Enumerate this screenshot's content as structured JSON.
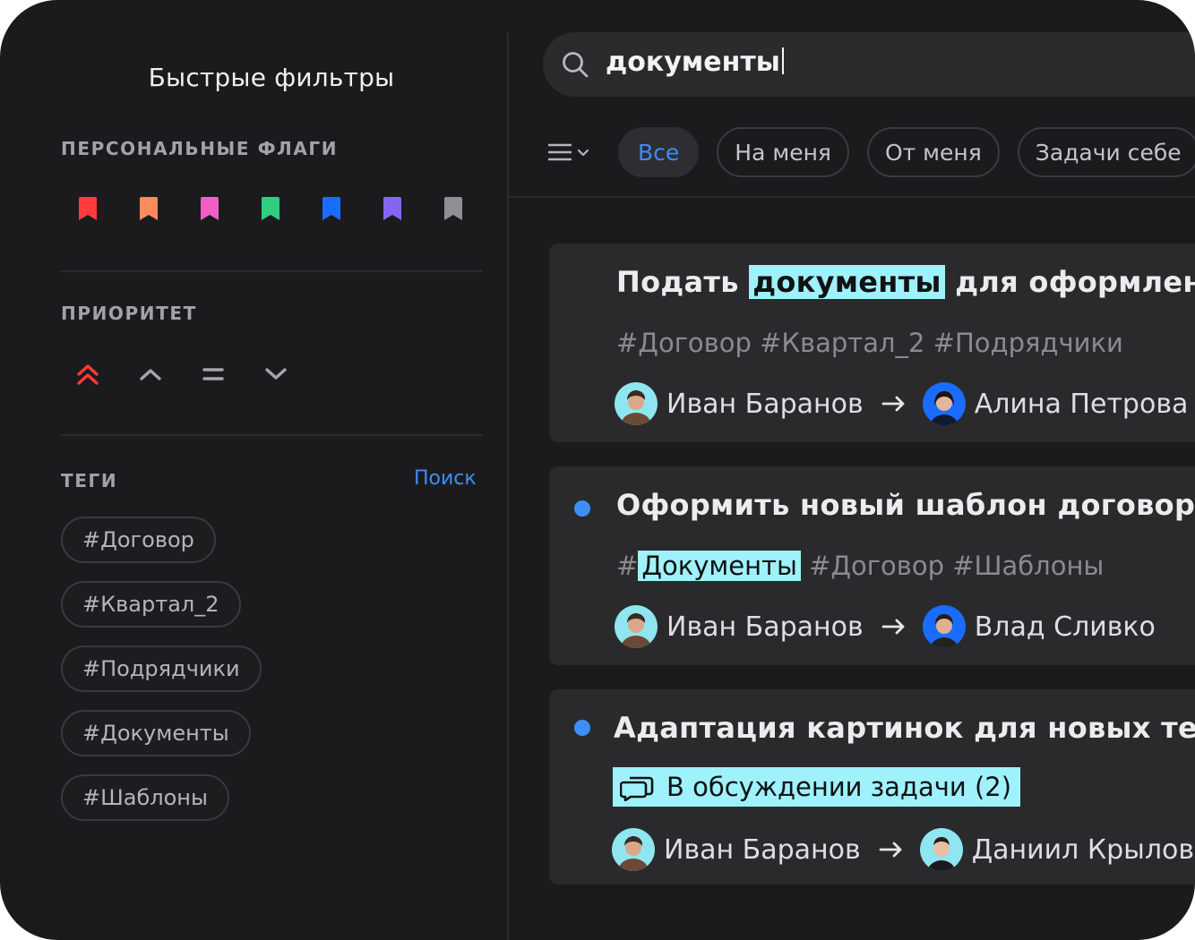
{
  "sidebar": {
    "title": "Быстрые фильтры",
    "flags": {
      "heading": "ПЕРСОНАЛЬНЫЕ ФЛАГИ",
      "items": [
        {
          "name": "red",
          "color": "#ff3b3b"
        },
        {
          "name": "orange",
          "color": "#ff8a5b"
        },
        {
          "name": "pink",
          "color": "#f25fc4"
        },
        {
          "name": "green",
          "color": "#2fcf7f"
        },
        {
          "name": "blue",
          "color": "#1a6cff"
        },
        {
          "name": "purple",
          "color": "#8566f2"
        },
        {
          "name": "gray",
          "color": "#8e8e94"
        }
      ]
    },
    "priority": {
      "heading": "ПРИОРИТЕТ",
      "items": [
        {
          "name": "highest",
          "icon": "double-chevron-up-icon",
          "color": "#ff3b3b"
        },
        {
          "name": "high",
          "icon": "chevron-up-icon",
          "color": "#a5a5aa"
        },
        {
          "name": "medium",
          "icon": "equals-icon",
          "color": "#a5a5aa"
        },
        {
          "name": "low",
          "icon": "chevron-down-icon",
          "color": "#a5a5aa"
        }
      ]
    },
    "tags": {
      "heading": "ТЕГИ",
      "search_label": "Поиск",
      "items": [
        "#Договор",
        "#Квартал_2",
        "#Подрядчики",
        "#Документы",
        "#Шаблоны"
      ]
    }
  },
  "search": {
    "value": "документы"
  },
  "filters": {
    "items": [
      {
        "label": "Все",
        "active": true
      },
      {
        "label": "На меня",
        "active": false
      },
      {
        "label": "От меня",
        "active": false
      },
      {
        "label": "Задачи себе",
        "active": false
      }
    ]
  },
  "tasks": [
    {
      "title_before": "Подать ",
      "title_highlight": "документы",
      "title_after": " для оформления",
      "tags_text": "#Договор #Квартал_2 #Подрядчики",
      "from": "Иван Баранов",
      "to": "Алина Петрова",
      "unread": false
    },
    {
      "title": "Оформить новый шаблон договора",
      "tags_prefix": "#",
      "tags_highlight": "Документы",
      "tags_after": " #Договор #Шаблоны",
      "from": "Иван Баранов",
      "to": "Влад Сливко",
      "unread": true
    },
    {
      "title": "Адаптация картинок для новых тем",
      "discussion": "В обсуждении задачи (2)",
      "from": "Иван Баранов",
      "to": "Даниил Крылов",
      "unread": true
    }
  ],
  "colors": {
    "accent": "#3b8cf5",
    "highlight": "#9ff2fb",
    "background": "#1b1b1d",
    "card": "#2a2a2d"
  }
}
